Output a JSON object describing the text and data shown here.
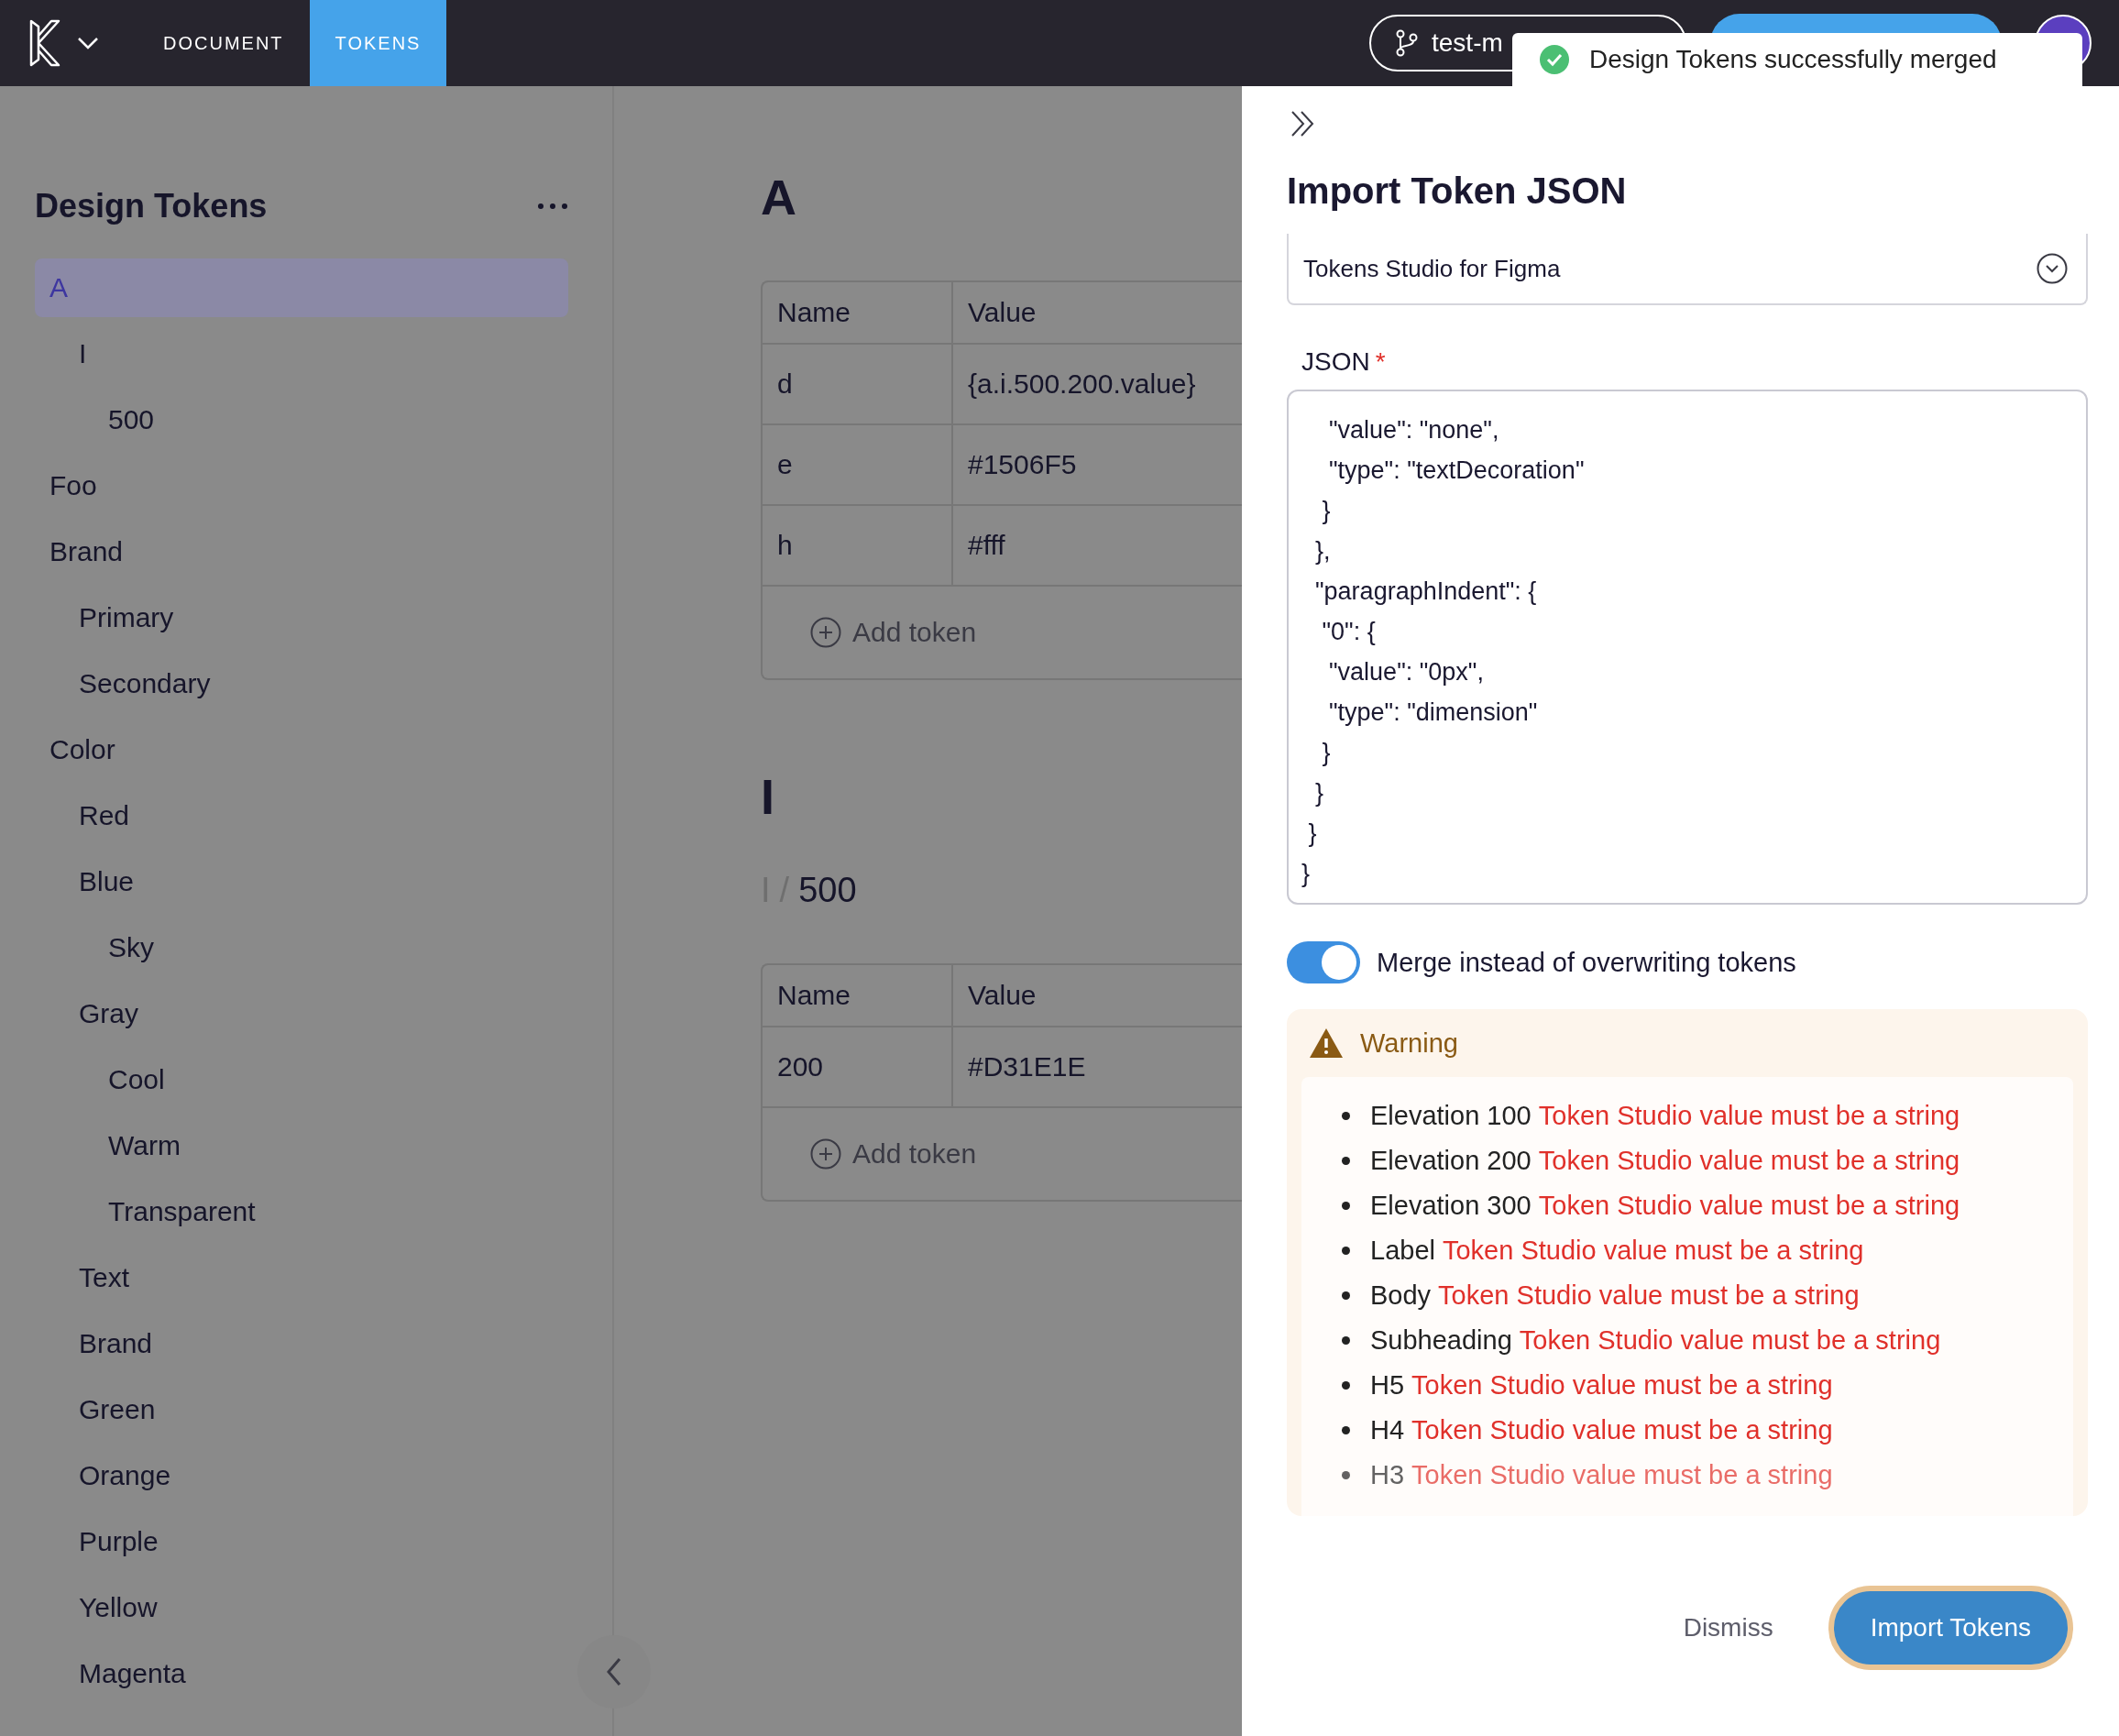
{
  "top_bar": {
    "tabs": [
      {
        "label": "DOCUMENT",
        "selected": false
      },
      {
        "label": "TOKENS",
        "selected": true
      }
    ],
    "branch": "test-m",
    "toast": "Design Tokens successfully merged"
  },
  "sidebar": {
    "title": "Design Tokens",
    "tree": [
      {
        "label": "A",
        "selected": true,
        "children": [
          {
            "label": "I",
            "selected": false,
            "children": [
              {
                "label": "500",
                "selected": false
              }
            ]
          }
        ]
      },
      {
        "label": "Foo",
        "selected": false
      },
      {
        "label": "Brand",
        "selected": false,
        "children": [
          {
            "label": "Primary",
            "selected": false
          },
          {
            "label": "Secondary",
            "selected": false
          }
        ]
      },
      {
        "label": "Color",
        "selected": false,
        "children": [
          {
            "label": "Red",
            "selected": false
          },
          {
            "label": "Blue",
            "selected": false,
            "children": [
              {
                "label": "Sky",
                "selected": false
              }
            ]
          },
          {
            "label": "Gray",
            "selected": false,
            "children": [
              {
                "label": "Cool",
                "selected": false
              },
              {
                "label": "Warm",
                "selected": false
              },
              {
                "label": "Transparent",
                "selected": false
              }
            ]
          },
          {
            "label": "Text",
            "selected": false
          },
          {
            "label": "Brand",
            "selected": false
          },
          {
            "label": "Green",
            "selected": false
          },
          {
            "label": "Orange",
            "selected": false
          },
          {
            "label": "Purple",
            "selected": false
          },
          {
            "label": "Yellow",
            "selected": false
          },
          {
            "label": "Magenta",
            "selected": false
          }
        ]
      }
    ]
  },
  "main": {
    "sections": [
      {
        "kind": "group",
        "title": "A",
        "table": {
          "columns": [
            "Name",
            "Value"
          ],
          "rows": [
            [
              "d",
              "{a.i.500.200.value}"
            ],
            [
              "e",
              "#1506F5"
            ],
            [
              "h",
              "#fff"
            ]
          ],
          "add_label": "Add token"
        }
      },
      {
        "kind": "group",
        "title": "I"
      },
      {
        "kind": "subgroup",
        "parent": "I",
        "separator": "/",
        "title": "500",
        "table": {
          "columns": [
            "Name",
            "Value"
          ],
          "rows": [
            [
              "200",
              "#D31E1E"
            ]
          ],
          "add_label": "Add token"
        }
      }
    ]
  },
  "panel": {
    "title": "Import Token JSON",
    "format": "Tokens Studio for Figma",
    "json_label": "JSON",
    "required_mark": "*",
    "code_lines": [
      "    \"value\": \"none\",",
      "    \"type\": \"textDecoration\"",
      "   }",
      "  },",
      "  \"paragraphIndent\": {",
      "   \"0\": {",
      "    \"value\": \"0px\",",
      "    \"type\": \"dimension\"",
      "   }",
      "  }",
      " }",
      "}"
    ],
    "merge": {
      "label": "Merge instead of overwriting tokens",
      "on": true
    },
    "warning": {
      "title": "Warning",
      "items": [
        {
          "name": "Elevation 100",
          "message": "Token Studio value must be a string"
        },
        {
          "name": "Elevation 200",
          "message": "Token Studio value must be a string"
        },
        {
          "name": "Elevation 300",
          "message": "Token Studio value must be a string"
        },
        {
          "name": "Label",
          "message": "Token Studio value must be a string"
        },
        {
          "name": "Body",
          "message": "Token Studio value must be a string"
        },
        {
          "name": "Subheading",
          "message": "Token Studio value must be a string"
        },
        {
          "name": "H5",
          "message": "Token Studio value must be a string"
        },
        {
          "name": "H4",
          "message": "Token Studio value must be a string"
        },
        {
          "name": "H3",
          "message": "Token Studio value must be a string"
        }
      ]
    },
    "buttons": [
      {
        "label": "Dismiss",
        "kind": "secondary"
      },
      {
        "label": "Import Tokens",
        "kind": "primary"
      }
    ]
  }
}
